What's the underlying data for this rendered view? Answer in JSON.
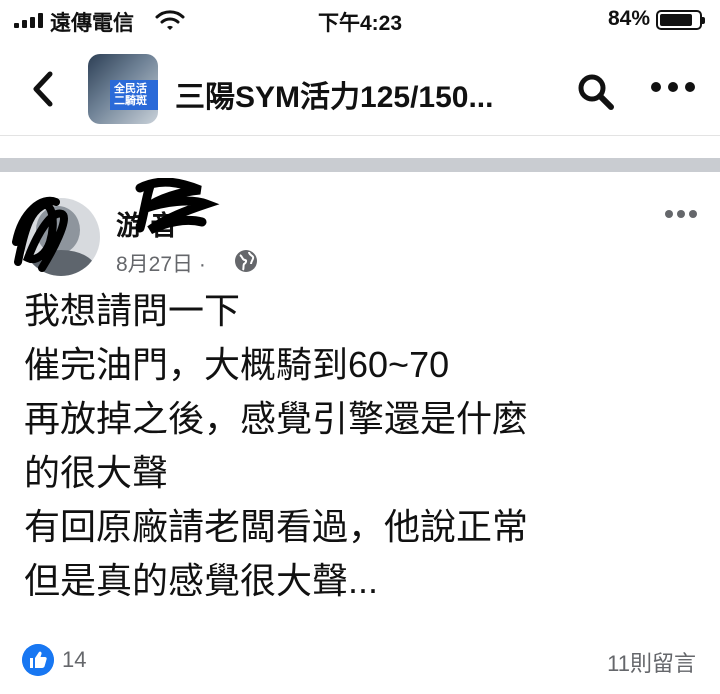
{
  "status_bar": {
    "carrier": "遠傳電信",
    "time": "下午4:23",
    "battery_percent_label": "84%",
    "battery_level": 0.84
  },
  "nav": {
    "group_title": "三陽SYM活力125/150...",
    "group_avatar_text": "全民活\n二騎斑"
  },
  "post": {
    "author": "游  音",
    "date": "8月27日",
    "privacy_separator": "·",
    "body_lines": [
      "我想請問一下",
      "催完油門，大概騎到60~70",
      "再放掉之後，感覺引擎還是什麼",
      "的很大聲",
      "有回原廠請老闆看過，他說正常",
      "但是真的感覺很大聲..."
    ],
    "reaction_count": "14",
    "comment_count": "11則留言"
  },
  "colors": {
    "like_blue": "#1877f2",
    "secondary_text": "#65676b",
    "divider": "#c9ccd1"
  }
}
